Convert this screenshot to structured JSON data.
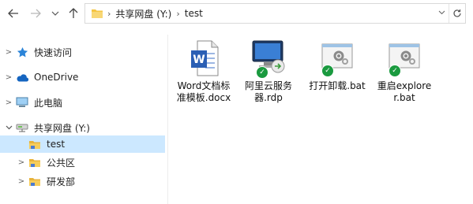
{
  "address": {
    "path": [
      "共享网盘 (Y:)",
      "test"
    ]
  },
  "nav": {
    "items": [
      {
        "label": "快速访问",
        "icon": "star-icon",
        "chevron": ">"
      },
      {
        "label": "OneDrive",
        "icon": "cloud-icon",
        "chevron": ">"
      },
      {
        "label": "此电脑",
        "icon": "computer-icon",
        "chevron": ">"
      },
      {
        "label": "共享网盘 (Y:)",
        "icon": "network-drive-icon",
        "chevron": "v"
      },
      {
        "label": "test",
        "icon": "folder-icon",
        "chevron": ""
      },
      {
        "label": "公共区",
        "icon": "folder-icon",
        "chevron": ">"
      },
      {
        "label": "研发部",
        "icon": "folder-icon",
        "chevron": ">"
      }
    ]
  },
  "files": [
    {
      "name": "Word文档标准模板.docx",
      "icon": "word-document-icon"
    },
    {
      "name": "阿里云服务器.rdp",
      "icon": "remote-desktop-icon"
    },
    {
      "name": "打开卸载.bat",
      "icon": "batch-file-icon"
    },
    {
      "name": "重启explorer.bat",
      "icon": "batch-file-icon"
    }
  ]
}
